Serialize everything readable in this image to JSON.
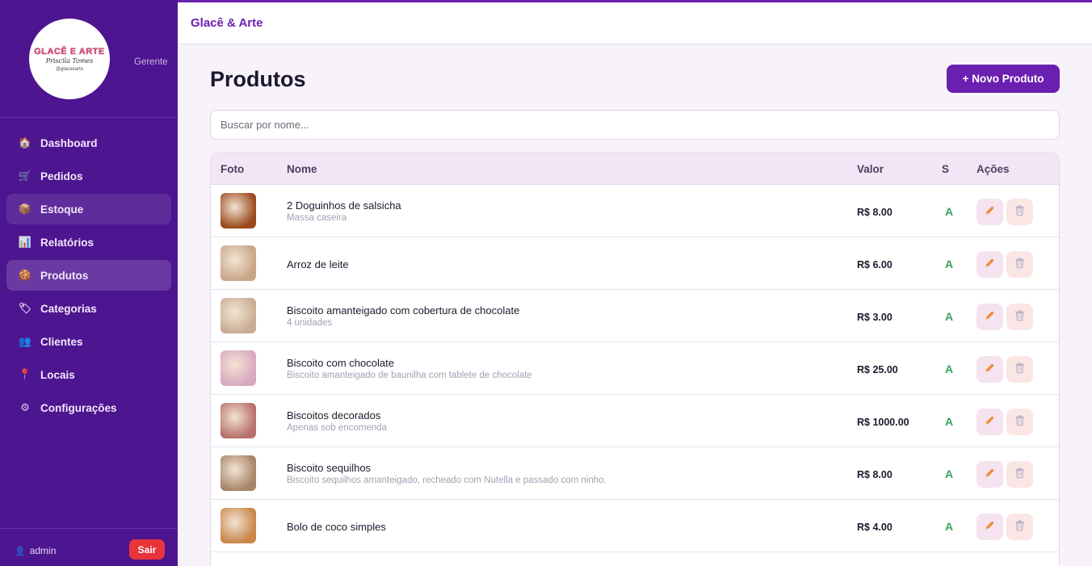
{
  "sidebar": {
    "logo": {
      "title": "GLACÊ E ARTE",
      "subtitle": "Priscila Tomes",
      "handle": "@glaceearte"
    },
    "role": "Gerente",
    "items": [
      {
        "label": "Dashboard",
        "icon": "house-icon",
        "glyph": "🏠"
      },
      {
        "label": "Pedidos",
        "icon": "cart-icon",
        "glyph": "🛒"
      },
      {
        "label": "Estoque",
        "icon": "box-icon",
        "glyph": "📦"
      },
      {
        "label": "Relatórios",
        "icon": "chart-icon",
        "glyph": "📊"
      },
      {
        "label": "Produtos",
        "icon": "cookie-icon",
        "glyph": "🍪"
      },
      {
        "label": "Categorias",
        "icon": "tag-icon",
        "glyph": "🏷"
      },
      {
        "label": "Clientes",
        "icon": "users-icon",
        "glyph": "👥"
      },
      {
        "label": "Locais",
        "icon": "pin-icon",
        "glyph": "📍"
      },
      {
        "label": "Configurações",
        "icon": "gear-icon",
        "glyph": "⚙"
      }
    ],
    "user": "admin",
    "logout_label": "Sair"
  },
  "topbar": {
    "brand": "Glacê & Arte"
  },
  "main": {
    "title": "Produtos",
    "new_button": "+ Novo Produto",
    "search_placeholder": "Buscar por nome..."
  },
  "table": {
    "headers": {
      "foto": "Foto",
      "nome": "Nome",
      "valor": "Valor",
      "status": "S",
      "acoes": "Ações"
    },
    "rows": [
      {
        "name": "2 Doguinhos de salsicha",
        "desc": "Massa caseira",
        "price": "R$ 8.00",
        "status": "A",
        "thumb": "#9a4a1c"
      },
      {
        "name": "Arroz de leite",
        "desc": "",
        "price": "R$ 6.00",
        "status": "A",
        "thumb": "#c9a688"
      },
      {
        "name": "Biscoito amanteigado com cobertura de chocolate",
        "desc": "4 unidades",
        "price": "R$ 3.00",
        "status": "A",
        "thumb": "#c8ad93"
      },
      {
        "name": "Biscoito com chocolate",
        "desc": "Biscoito amanteigado de baunilha com tablete de chocolate",
        "price": "R$ 25.00",
        "status": "A",
        "thumb": "#d9a8c0"
      },
      {
        "name": "Biscoitos decorados",
        "desc": "Apenas sob encomenda",
        "price": "R$ 1000.00",
        "status": "A",
        "thumb": "#b8706a"
      },
      {
        "name": "Biscoito sequilhos",
        "desc": "Biscoito sequilhos amanteigado, recheado com Nutella e passado com ninho.",
        "price": "R$ 8.00",
        "status": "A",
        "thumb": "#a88568"
      },
      {
        "name": "Bolo de coco simples",
        "desc": "",
        "price": "R$ 4.00",
        "status": "A",
        "thumb": "#c9864a"
      }
    ]
  },
  "colors": {
    "sidebar": "#4d1590",
    "accent": "#6b1fb0",
    "danger": "#e8343b",
    "status_active": "#3aa35b"
  }
}
